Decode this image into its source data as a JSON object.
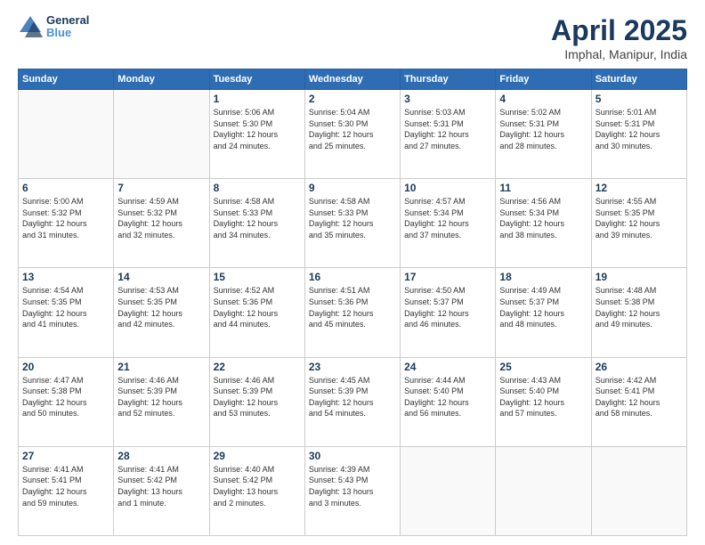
{
  "header": {
    "logo_line1": "General",
    "logo_line2": "Blue",
    "title": "April 2025",
    "subtitle": "Imphal, Manipur, India"
  },
  "columns": [
    "Sunday",
    "Monday",
    "Tuesday",
    "Wednesday",
    "Thursday",
    "Friday",
    "Saturday"
  ],
  "weeks": [
    [
      {
        "day": "",
        "info": ""
      },
      {
        "day": "",
        "info": ""
      },
      {
        "day": "1",
        "info": "Sunrise: 5:06 AM\nSunset: 5:30 PM\nDaylight: 12 hours\nand 24 minutes."
      },
      {
        "day": "2",
        "info": "Sunrise: 5:04 AM\nSunset: 5:30 PM\nDaylight: 12 hours\nand 25 minutes."
      },
      {
        "day": "3",
        "info": "Sunrise: 5:03 AM\nSunset: 5:31 PM\nDaylight: 12 hours\nand 27 minutes."
      },
      {
        "day": "4",
        "info": "Sunrise: 5:02 AM\nSunset: 5:31 PM\nDaylight: 12 hours\nand 28 minutes."
      },
      {
        "day": "5",
        "info": "Sunrise: 5:01 AM\nSunset: 5:31 PM\nDaylight: 12 hours\nand 30 minutes."
      }
    ],
    [
      {
        "day": "6",
        "info": "Sunrise: 5:00 AM\nSunset: 5:32 PM\nDaylight: 12 hours\nand 31 minutes."
      },
      {
        "day": "7",
        "info": "Sunrise: 4:59 AM\nSunset: 5:32 PM\nDaylight: 12 hours\nand 32 minutes."
      },
      {
        "day": "8",
        "info": "Sunrise: 4:58 AM\nSunset: 5:33 PM\nDaylight: 12 hours\nand 34 minutes."
      },
      {
        "day": "9",
        "info": "Sunrise: 4:58 AM\nSunset: 5:33 PM\nDaylight: 12 hours\nand 35 minutes."
      },
      {
        "day": "10",
        "info": "Sunrise: 4:57 AM\nSunset: 5:34 PM\nDaylight: 12 hours\nand 37 minutes."
      },
      {
        "day": "11",
        "info": "Sunrise: 4:56 AM\nSunset: 5:34 PM\nDaylight: 12 hours\nand 38 minutes."
      },
      {
        "day": "12",
        "info": "Sunrise: 4:55 AM\nSunset: 5:35 PM\nDaylight: 12 hours\nand 39 minutes."
      }
    ],
    [
      {
        "day": "13",
        "info": "Sunrise: 4:54 AM\nSunset: 5:35 PM\nDaylight: 12 hours\nand 41 minutes."
      },
      {
        "day": "14",
        "info": "Sunrise: 4:53 AM\nSunset: 5:35 PM\nDaylight: 12 hours\nand 42 minutes."
      },
      {
        "day": "15",
        "info": "Sunrise: 4:52 AM\nSunset: 5:36 PM\nDaylight: 12 hours\nand 44 minutes."
      },
      {
        "day": "16",
        "info": "Sunrise: 4:51 AM\nSunset: 5:36 PM\nDaylight: 12 hours\nand 45 minutes."
      },
      {
        "day": "17",
        "info": "Sunrise: 4:50 AM\nSunset: 5:37 PM\nDaylight: 12 hours\nand 46 minutes."
      },
      {
        "day": "18",
        "info": "Sunrise: 4:49 AM\nSunset: 5:37 PM\nDaylight: 12 hours\nand 48 minutes."
      },
      {
        "day": "19",
        "info": "Sunrise: 4:48 AM\nSunset: 5:38 PM\nDaylight: 12 hours\nand 49 minutes."
      }
    ],
    [
      {
        "day": "20",
        "info": "Sunrise: 4:47 AM\nSunset: 5:38 PM\nDaylight: 12 hours\nand 50 minutes."
      },
      {
        "day": "21",
        "info": "Sunrise: 4:46 AM\nSunset: 5:39 PM\nDaylight: 12 hours\nand 52 minutes."
      },
      {
        "day": "22",
        "info": "Sunrise: 4:46 AM\nSunset: 5:39 PM\nDaylight: 12 hours\nand 53 minutes."
      },
      {
        "day": "23",
        "info": "Sunrise: 4:45 AM\nSunset: 5:39 PM\nDaylight: 12 hours\nand 54 minutes."
      },
      {
        "day": "24",
        "info": "Sunrise: 4:44 AM\nSunset: 5:40 PM\nDaylight: 12 hours\nand 56 minutes."
      },
      {
        "day": "25",
        "info": "Sunrise: 4:43 AM\nSunset: 5:40 PM\nDaylight: 12 hours\nand 57 minutes."
      },
      {
        "day": "26",
        "info": "Sunrise: 4:42 AM\nSunset: 5:41 PM\nDaylight: 12 hours\nand 58 minutes."
      }
    ],
    [
      {
        "day": "27",
        "info": "Sunrise: 4:41 AM\nSunset: 5:41 PM\nDaylight: 12 hours\nand 59 minutes."
      },
      {
        "day": "28",
        "info": "Sunrise: 4:41 AM\nSunset: 5:42 PM\nDaylight: 13 hours\nand 1 minute."
      },
      {
        "day": "29",
        "info": "Sunrise: 4:40 AM\nSunset: 5:42 PM\nDaylight: 13 hours\nand 2 minutes."
      },
      {
        "day": "30",
        "info": "Sunrise: 4:39 AM\nSunset: 5:43 PM\nDaylight: 13 hours\nand 3 minutes."
      },
      {
        "day": "",
        "info": ""
      },
      {
        "day": "",
        "info": ""
      },
      {
        "day": "",
        "info": ""
      }
    ]
  ]
}
